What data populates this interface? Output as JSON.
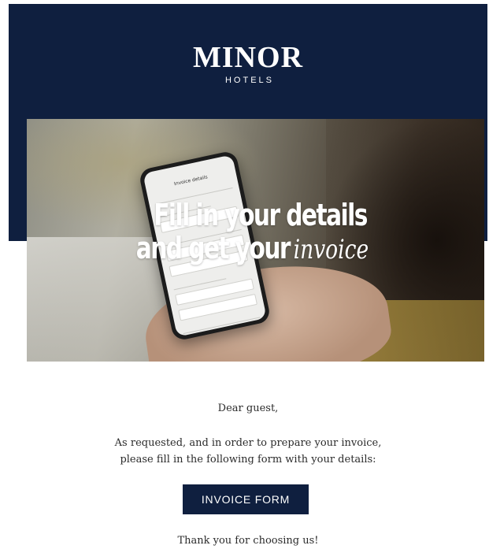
{
  "brand": {
    "name": "MINOR",
    "subname": "HOTELS"
  },
  "hero": {
    "headline_line1": "Fill in your details",
    "headline_line2_prefix": "and get your",
    "headline_line2_script": "invoice",
    "phone_screen_title": "Invoice details"
  },
  "body": {
    "greeting": "Dear guest,",
    "paragraph_line1": "As requested, and in order to prepare your invoice,",
    "paragraph_line2": "please fill in the following form with your details:",
    "cta_label": "INVOICE FORM",
    "thanks": "Thank you for choosing us!"
  },
  "colors": {
    "brand_navy": "#0f1f3f",
    "background": "#ffffff",
    "text": "#2b2b2b"
  }
}
